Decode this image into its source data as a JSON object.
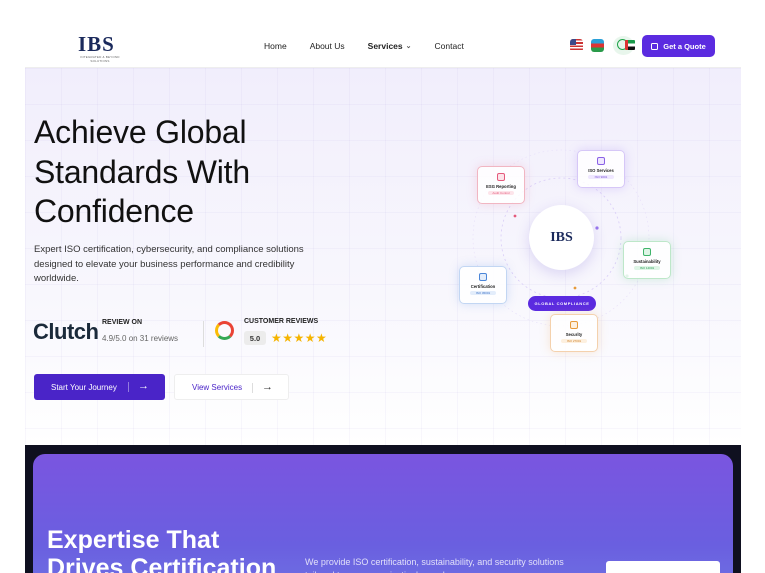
{
  "header": {
    "logo_text": "IBS",
    "logo_sub": "INTEGRATED & BEYOND SOLUTIONS",
    "nav": {
      "home": "Home",
      "about": "About Us",
      "services": "Services",
      "contact": "Contact"
    },
    "services_chevron": "⌄",
    "quote_button": "Get a Quote"
  },
  "hero": {
    "title": "Achieve Global Standards With Confidence",
    "subtitle": "Expert ISO certification, cybersecurity, and compliance solutions designed to elevate your business performance and credibility worldwide.",
    "clutch": {
      "brand": "Clutch",
      "label": "REVIEW ON",
      "score": "4.9/5.0 on 31 reviews"
    },
    "google": {
      "label": "CUSTOMER REVIEWS",
      "score": "5.0",
      "stars": "★★★★★"
    },
    "primary_button": "Start Your Journey",
    "secondary_button": "View Services",
    "arrow": "→"
  },
  "diagram": {
    "center": "IBS",
    "pill": "GLOBAL COMPLIANCE",
    "cards": {
      "reporting": {
        "title": "ESG Reporting",
        "badge": "Audit Control"
      },
      "iso": {
        "title": "ISO Services",
        "badge": "ISO 9001"
      },
      "sustainability": {
        "title": "Sustainability",
        "badge": "ISO 14001"
      },
      "certification": {
        "title": "Certification",
        "badge": "ISO 45001"
      },
      "security": {
        "title": "Security",
        "badge": "ISO 27001"
      }
    }
  },
  "section2": {
    "title": "Expertise That Drives Certification",
    "text": "We provide ISO certification, sustainability, and security solutions tailored to your organization's needs."
  },
  "colors": {
    "accent": "#5b2be0",
    "primary_button": "#4a24c8",
    "section_bg": "#7a55e0"
  }
}
